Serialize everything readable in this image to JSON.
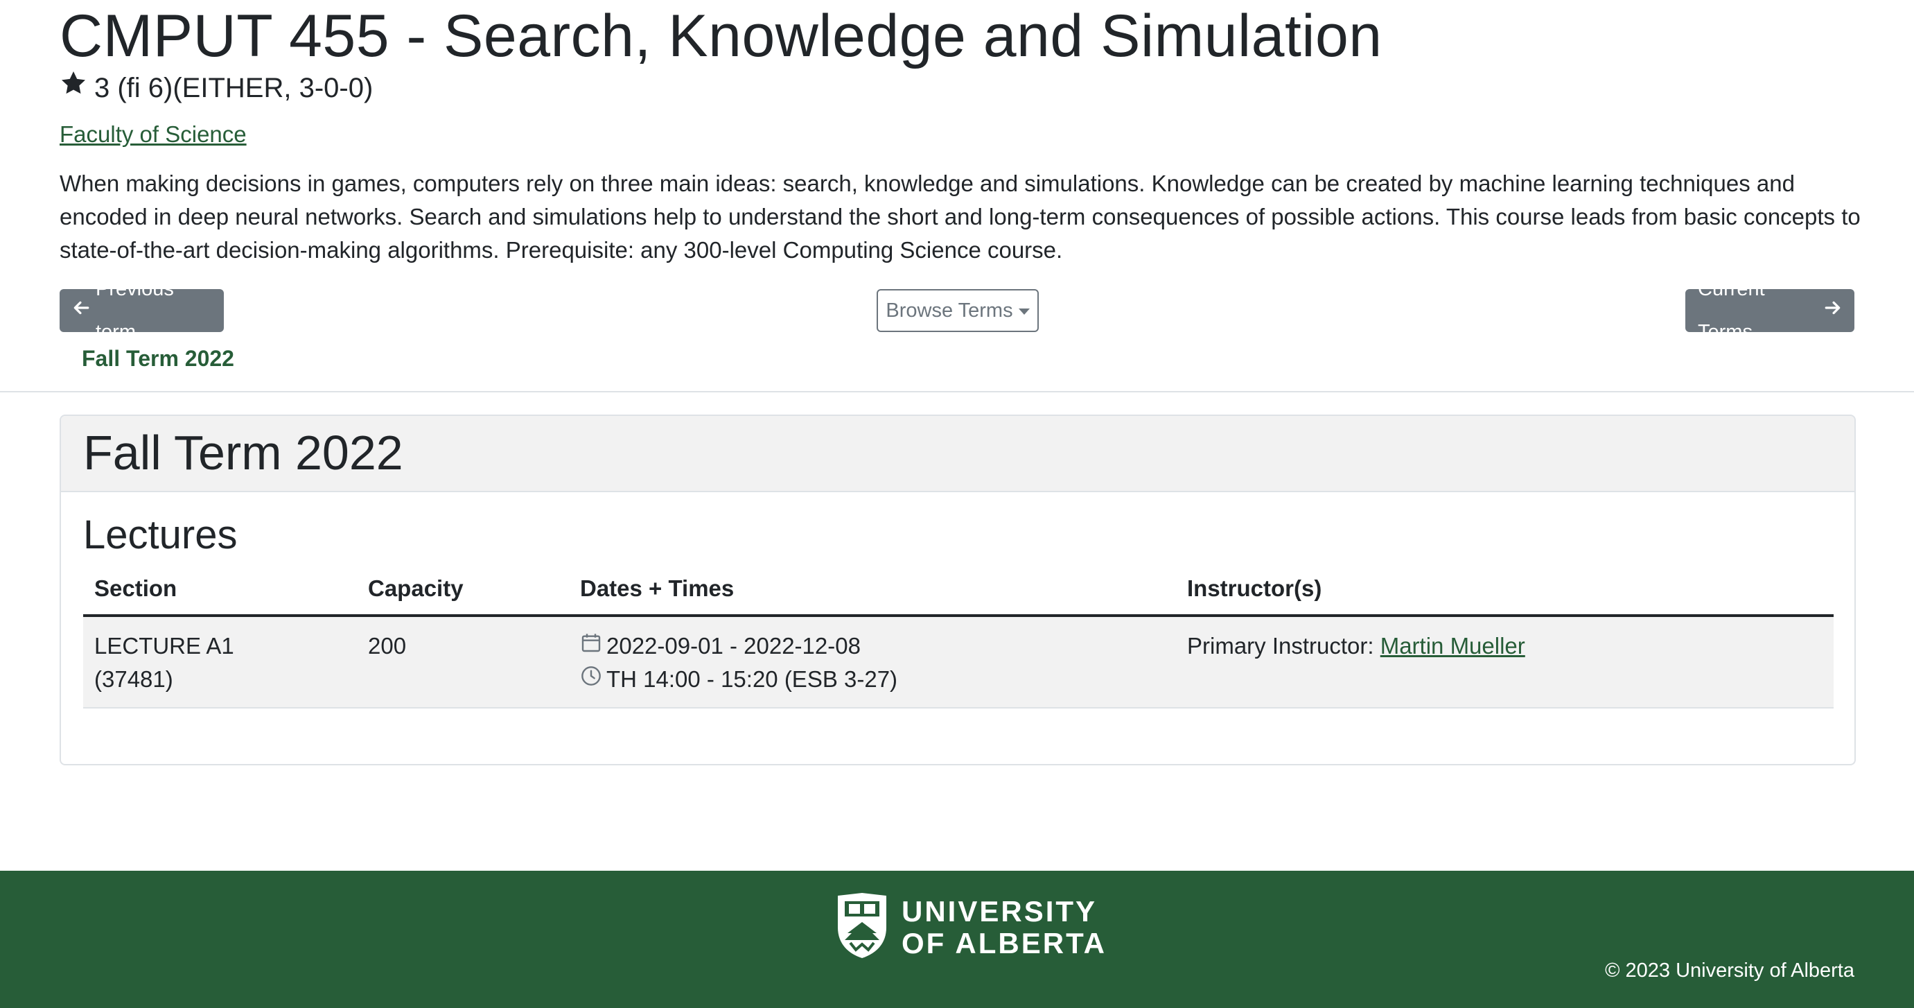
{
  "course": {
    "title": "CMPUT 455 - Search, Knowledge and Simulation",
    "units": "3 (fi 6)(EITHER, 3-0-0)",
    "faculty": "Faculty of Science",
    "description": "When making decisions in games, computers rely on three main ideas: search, knowledge and simulations. Knowledge can be created by machine learning techniques and encoded in deep neural networks. Search and simulations help to understand the short and long-term consequences of possible actions. This course leads from basic concepts to state-of-the-art decision-making algorithms. Prerequisite: any 300-level Computing Science course."
  },
  "nav": {
    "previous_label": "Previous term",
    "browse_label": "Browse Terms",
    "current_label": "Current Terms",
    "selected_term": "Fall Term 2022"
  },
  "term_card": {
    "title": "Fall Term 2022",
    "section_heading": "Lectures",
    "columns": [
      "Section",
      "Capacity",
      "Dates + Times",
      "Instructor(s)"
    ],
    "rows": [
      {
        "section": "LECTURE A1",
        "section_id": "(37481)",
        "capacity": "200",
        "dates": "2022-09-01 - 2022-12-08",
        "times": "TH 14:00 - 15:20 (ESB 3-27)",
        "instructor_prefix": "Primary Instructor:",
        "instructor_name": "Martin Mueller"
      }
    ]
  },
  "footer": {
    "logo_line1": "UNIVERSITY",
    "logo_line2": "OF ALBERTA",
    "copyright": "© 2023 University of Alberta"
  },
  "colors": {
    "brand_green": "#275d38",
    "button_gray": "#6c757d"
  }
}
